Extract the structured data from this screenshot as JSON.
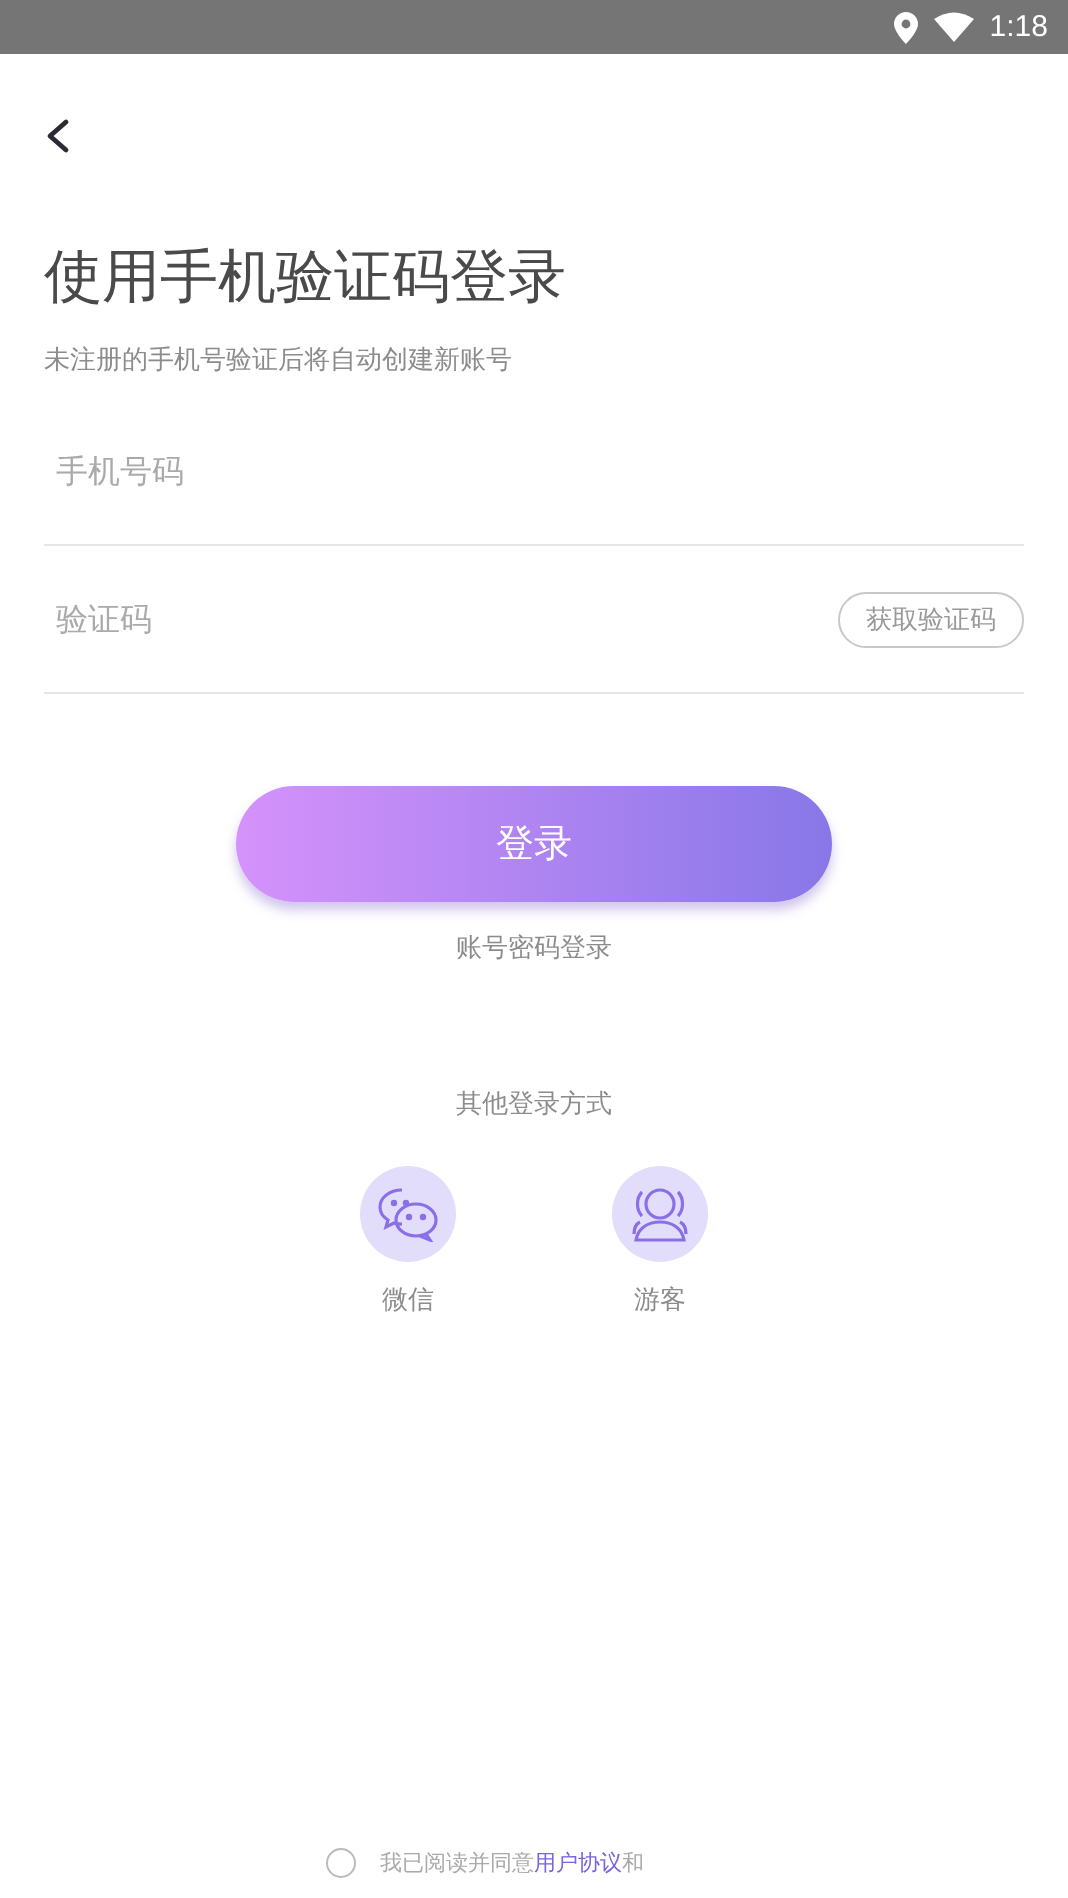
{
  "status_bar": {
    "time": "1:18"
  },
  "title": "使用手机验证码登录",
  "subtitle": "未注册的手机号验证后将自动创建新账号",
  "fields": [
    {
      "kind": "phone",
      "placeholder": "手机号码"
    },
    {
      "kind": "code",
      "placeholder": "验证码",
      "action": "获取验证码"
    }
  ],
  "login_button": "登录",
  "password_login": "账号密码登录",
  "other_title": "其他登录方式",
  "other_methods": [
    {
      "kind": "wechat",
      "label": "微信"
    },
    {
      "kind": "guest",
      "label": "游客"
    }
  ],
  "agreement": {
    "checked": false,
    "text_before": "我已阅读并同意",
    "link": "用户协议",
    "text_after": "和"
  }
}
